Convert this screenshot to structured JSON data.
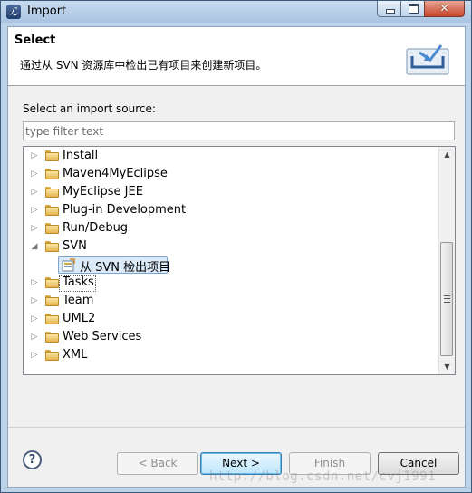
{
  "window": {
    "title": "Import"
  },
  "banner": {
    "title": "Select",
    "description": "通过从 SVN 资源库中检出已有项目来创建新项目。",
    "icon": "import-wizard-icon"
  },
  "source": {
    "label": "Select an import source:",
    "filter_placeholder": "type filter text",
    "filter_value": ""
  },
  "tree": {
    "items": [
      {
        "label": "Install",
        "type": "folder",
        "expanded": false
      },
      {
        "label": "Maven4MyEclipse",
        "type": "folder",
        "expanded": false
      },
      {
        "label": "MyEclipse JEE",
        "type": "folder",
        "expanded": false
      },
      {
        "label": "Plug-in Development",
        "type": "folder",
        "expanded": false
      },
      {
        "label": "Run/Debug",
        "type": "folder",
        "expanded": false
      },
      {
        "label": "SVN",
        "type": "folder",
        "expanded": true
      },
      {
        "label": "从 SVN 检出项目",
        "type": "wizard",
        "selected": true
      },
      {
        "label": "Tasks",
        "type": "folder",
        "expanded": false,
        "focused": true
      },
      {
        "label": "Team",
        "type": "folder",
        "expanded": false
      },
      {
        "label": "UML2",
        "type": "folder",
        "expanded": false
      },
      {
        "label": "Web Services",
        "type": "folder",
        "expanded": false
      },
      {
        "label": "XML",
        "type": "folder",
        "expanded": false
      }
    ]
  },
  "buttons": {
    "help": "?",
    "back": "< Back",
    "next": "Next >",
    "finish": "Finish",
    "cancel": "Cancel"
  },
  "watermark": "http://blog.csdn.net/cvj1991",
  "colors": {
    "selection_bg": "#dbebf9",
    "selection_border": "#7da2ce",
    "default_button_border": "#3c7fb1"
  }
}
